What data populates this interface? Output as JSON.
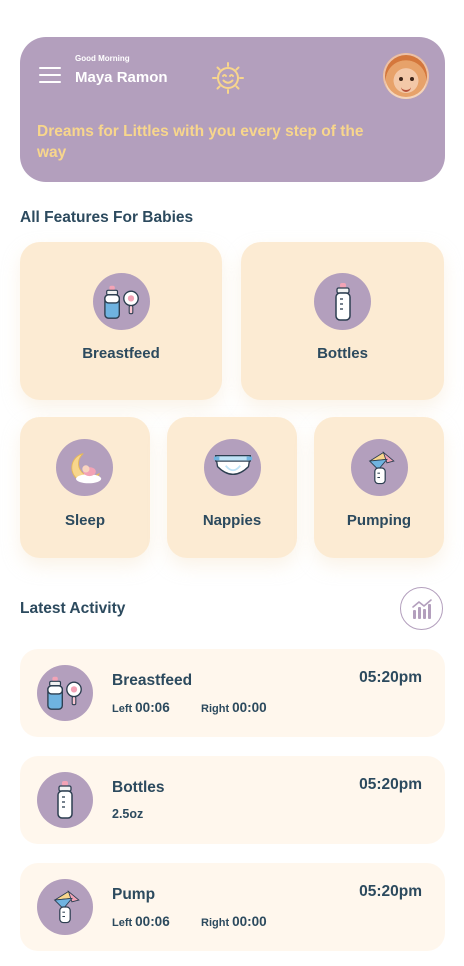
{
  "header": {
    "greeting": "Good Morning",
    "user_name": "Maya Ramon",
    "tagline": "Dreams for Littles with you every step of the way",
    "colors": {
      "background": "#b39fbd",
      "tagline": "#f8d68c",
      "sun": "#f8d68c"
    },
    "icons": {
      "menu": "menu-icon",
      "logo": "smiling-sun-icon",
      "avatar": "baby-avatar"
    }
  },
  "features": {
    "title": "All Features For Babies",
    "items": [
      {
        "label": "Breastfeed",
        "icon": "breastfeed-icon"
      },
      {
        "label": "Bottles",
        "icon": "bottle-icon"
      },
      {
        "label": "Sleep",
        "icon": "sleep-moon-icon"
      },
      {
        "label": "Nappies",
        "icon": "nappy-icon"
      },
      {
        "label": "Pumping",
        "icon": "pump-icon"
      }
    ]
  },
  "activity": {
    "title": "Latest Activity",
    "chart_icon": "bar-chart-icon",
    "items": [
      {
        "title": "Breastfeed",
        "time": "05:20pm",
        "left_label": "Left",
        "left_value": "00:06",
        "right_label": "Right",
        "right_value": "00:00",
        "icon": "breastfeed-icon"
      },
      {
        "title": "Bottles",
        "time": "05:20pm",
        "amount": "2.5oz",
        "icon": "bottle-icon"
      },
      {
        "title": "Pump",
        "time": "05:20pm",
        "left_label": "Left",
        "left_value": "00:06",
        "right_label": "Right",
        "right_value": "00:00",
        "icon": "pump-icon"
      }
    ]
  },
  "theme": {
    "card": "#fcebd3",
    "activity_card": "#fff7ed",
    "text": "#2c4a5e",
    "accent": "#b39fbd"
  }
}
